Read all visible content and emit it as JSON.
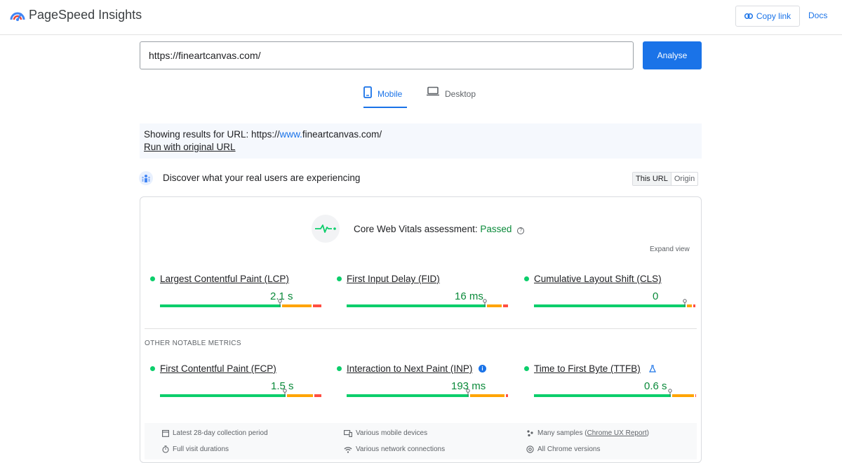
{
  "header": {
    "app_title": "PageSpeed Insights",
    "copy_link_label": "Copy link",
    "docs_label": "Docs"
  },
  "url_bar": {
    "value": "https://fineartcanvas.com/",
    "analyse_label": "Analyse"
  },
  "tabs": [
    {
      "label": "Mobile",
      "active": true
    },
    {
      "label": "Desktop",
      "active": false
    }
  ],
  "notice": {
    "prefix": "Showing results for URL: https://",
    "highlight": "www.",
    "suffix": "fineartcanvas.com/",
    "run_link": "Run with original URL"
  },
  "discover": {
    "title": "Discover what your real users are experiencing",
    "toggle": [
      "This URL",
      "Origin"
    ]
  },
  "assessment": {
    "label": "Core Web Vitals assessment:",
    "status": "Passed",
    "help": "?",
    "expand": "Expand view"
  },
  "core_metrics": [
    {
      "name": "Largest Contentful Paint (LCP)",
      "value": "2.1 s",
      "good": 0.75,
      "ni": 0.19
    },
    {
      "name": "First Input Delay (FID)",
      "value": "16 ms",
      "good": 0.86,
      "ni": 0.1
    },
    {
      "name": "Cumulative Layout Shift (CLS)",
      "value": "0",
      "good": 0.94,
      "ni": 0.04
    }
  ],
  "other_title": "OTHER NOTABLE METRICS",
  "other_metrics": [
    {
      "name": "First Contentful Paint (FCP)",
      "value": "1.5 s",
      "good": 0.78,
      "ni": 0.17,
      "badge": ""
    },
    {
      "name": "Interaction to Next Paint (INP)",
      "value": "193 ms",
      "good": 0.76,
      "ni": 0.22,
      "badge": "i"
    },
    {
      "name": "Time to First Byte (TTFB)",
      "value": "0.6 s",
      "good": 0.85,
      "ni": 0.14,
      "badge": "lab"
    }
  ],
  "facts": {
    "period": "Latest 28-day collection period",
    "devices": "Various mobile devices",
    "samples_prefix": "Many samples (",
    "samples_link": "Chrome UX Report",
    "samples_suffix": ")",
    "durations": "Full visit durations",
    "network": "Various network connections",
    "chrome": "All Chrome versions"
  },
  "colors": {
    "accent": "#1a73e8",
    "good": "#0cce6b",
    "needs_improvement": "#ffa400",
    "poor": "#ff4e42",
    "pass_text": "#0a8a3a"
  }
}
